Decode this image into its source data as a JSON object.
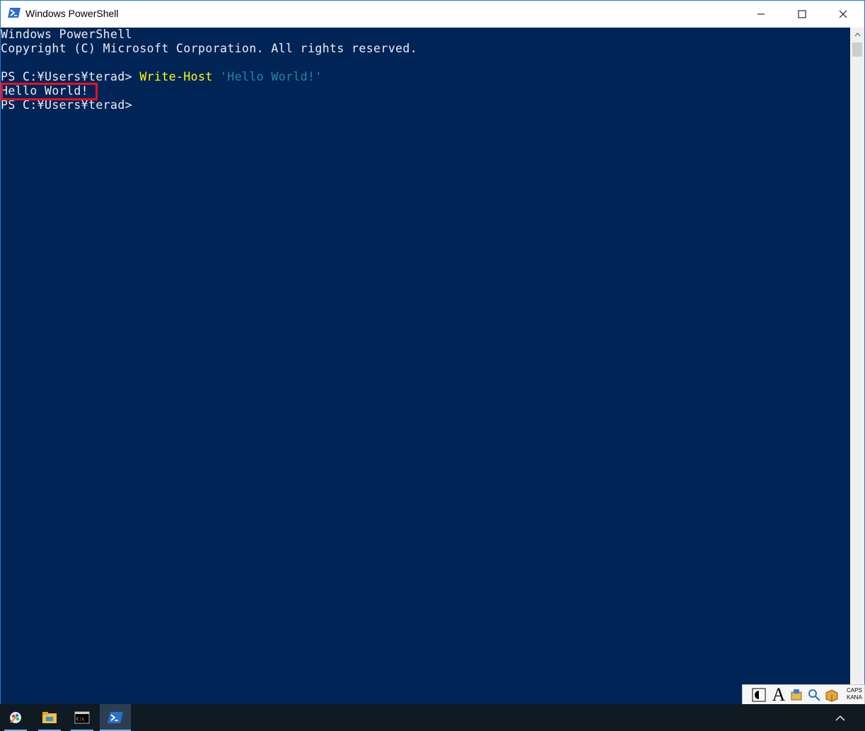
{
  "window": {
    "title": "Windows PowerShell"
  },
  "console": {
    "lines": [
      "Windows PowerShell",
      "Copyright (C) Microsoft Corporation. All rights reserved.",
      ""
    ],
    "prompt1": "PS C:¥Users¥terad> ",
    "command": "Write-Host",
    "argument": "'Hello World!'",
    "output": "Hello World!",
    "prompt2": "PS C:¥Users¥terad>"
  },
  "ime": {
    "caps": "CAPS",
    "kana": "KANA",
    "font_glyph": "A"
  },
  "colors": {
    "console_bg": "#012456",
    "console_fg": "#eeedf0",
    "command": "#ffff00",
    "string": "#1e8a9c",
    "highlight": "#e81123",
    "taskbar": "#101a23"
  },
  "taskbar": {
    "items": [
      "paint-icon",
      "file-explorer-icon",
      "command-prompt-icon",
      "powershell-icon"
    ]
  }
}
